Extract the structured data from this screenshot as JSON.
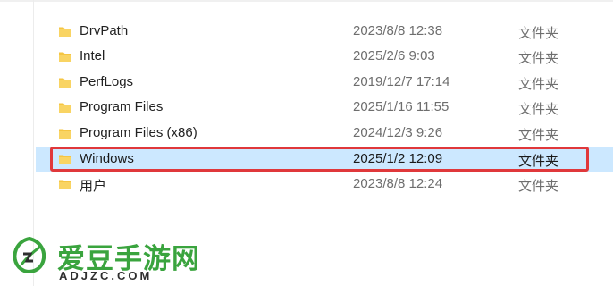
{
  "files": [
    {
      "name": "DrvPath",
      "date": "2023/8/8 12:38",
      "type": "文件夹",
      "selected": false
    },
    {
      "name": "Intel",
      "date": "2025/2/6 9:03",
      "type": "文件夹",
      "selected": false
    },
    {
      "name": "PerfLogs",
      "date": "2019/12/7 17:14",
      "type": "文件夹",
      "selected": false
    },
    {
      "name": "Program Files",
      "date": "2025/1/16 11:55",
      "type": "文件夹",
      "selected": false
    },
    {
      "name": "Program Files (x86)",
      "date": "2024/12/3 9:26",
      "type": "文件夹",
      "selected": false
    },
    {
      "name": "Windows",
      "date": "2025/1/2 12:09",
      "type": "文件夹",
      "selected": true
    },
    {
      "name": "用户",
      "date": "2023/8/8 12:24",
      "type": "文件夹",
      "selected": false
    }
  ],
  "watermark": {
    "title": "爱豆手游网",
    "subtitle": "ADJZC.COM"
  },
  "colors": {
    "folder": "#f5c542",
    "selection": "#cce8ff",
    "highlight": "#e0383b",
    "brand": "#3aa43e"
  },
  "icons": {
    "folder": "folder-icon",
    "logo": "leaf-logo-icon"
  }
}
